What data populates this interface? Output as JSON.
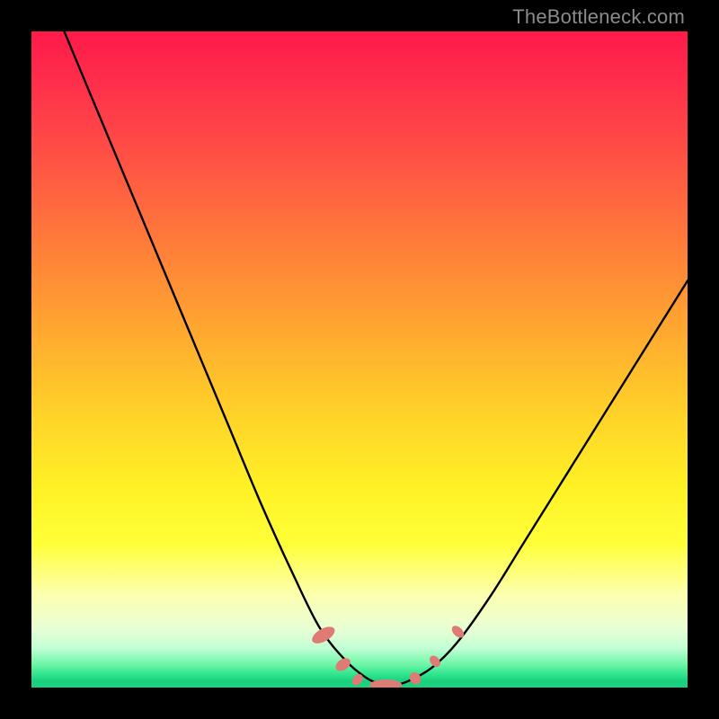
{
  "watermark": "TheBottleneck.com",
  "chart_data": {
    "type": "line",
    "title": "",
    "xlabel": "",
    "ylabel": "",
    "xlim": [
      0,
      100
    ],
    "ylim": [
      0,
      100
    ],
    "series": [
      {
        "name": "curve",
        "x": [
          5,
          10,
          15,
          20,
          25,
          30,
          35,
          40,
          44,
          48,
          51,
          53,
          55,
          57,
          61,
          65,
          70,
          75,
          80,
          85,
          90,
          95,
          100
        ],
        "y": [
          100,
          88,
          76,
          64,
          52,
          40,
          28,
          17,
          9,
          4,
          1.5,
          0.6,
          0.5,
          0.8,
          3,
          7,
          14,
          22,
          30,
          38,
          46,
          54,
          62
        ]
      }
    ],
    "markers": {
      "name": "segment-markers",
      "points": [
        {
          "x": 44.5,
          "y": 8.0,
          "rxp": 7,
          "ryp": 14,
          "rot": 60
        },
        {
          "x": 47.5,
          "y": 3.5,
          "rxp": 6,
          "ryp": 9,
          "rot": 55
        },
        {
          "x": 49.7,
          "y": 1.2,
          "rxp": 5,
          "ryp": 7,
          "rot": 40
        },
        {
          "x": 54.0,
          "y": 0.4,
          "rxp": 18,
          "ryp": 6,
          "rot": 0
        },
        {
          "x": 58.5,
          "y": 1.4,
          "rxp": 6,
          "ryp": 7,
          "rot": -32
        },
        {
          "x": 61.5,
          "y": 4.0,
          "rxp": 5,
          "ryp": 7,
          "rot": -40
        },
        {
          "x": 65.0,
          "y": 8.5,
          "rxp": 5,
          "ryp": 8,
          "rot": -45
        }
      ]
    },
    "gradient_stops": [
      {
        "pct": 0,
        "color": "#ff1a4a"
      },
      {
        "pct": 50,
        "color": "#ffb02e"
      },
      {
        "pct": 80,
        "color": "#ffff38"
      },
      {
        "pct": 100,
        "color": "#19d381"
      }
    ]
  }
}
